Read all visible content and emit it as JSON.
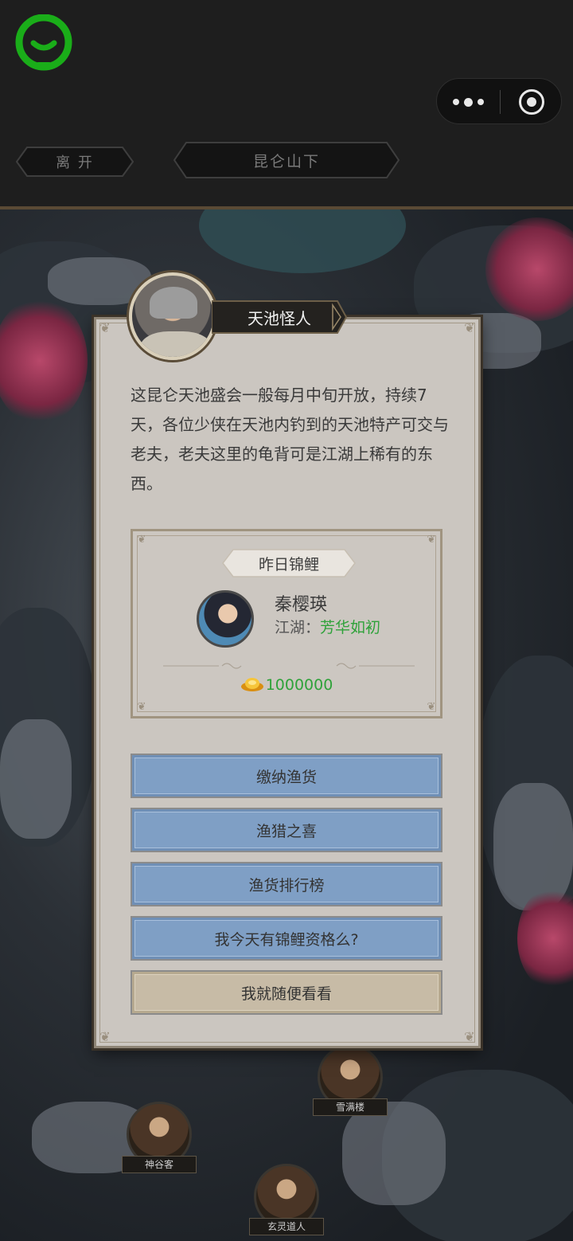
{
  "header": {
    "leave_label": "离 开",
    "location_label": "昆仑山下"
  },
  "dialog": {
    "npc_name": "天池怪人",
    "speech": "这昆仑天池盛会一般每月中旬开放，持续7天，各位少侠在天池内钓到的天池特产可交与老夫，老夫这里的龟背可是江湖上稀有的东西。",
    "carp": {
      "title": "昨日锦鲤",
      "winner_name": "秦樱瑛",
      "jianghu_label": "江湖：",
      "jianghu_value": "芳华如初",
      "reward": "1000000"
    },
    "actions": [
      {
        "label": "缴纳渔货"
      },
      {
        "label": "渔猎之喜"
      },
      {
        "label": "渔货排行榜"
      },
      {
        "label": "我今天有锦鲤资格么?"
      },
      {
        "label": "我就随便看看"
      }
    ]
  },
  "map_npcs": [
    {
      "name": "雪满楼"
    },
    {
      "name": "神谷客"
    },
    {
      "name": "玄灵道人"
    }
  ],
  "colors": {
    "logo_green": "#1aad19",
    "action_blue": "#7f9fc5",
    "action_tan": "#c7bba6",
    "reward_green": "#2fa23a"
  }
}
